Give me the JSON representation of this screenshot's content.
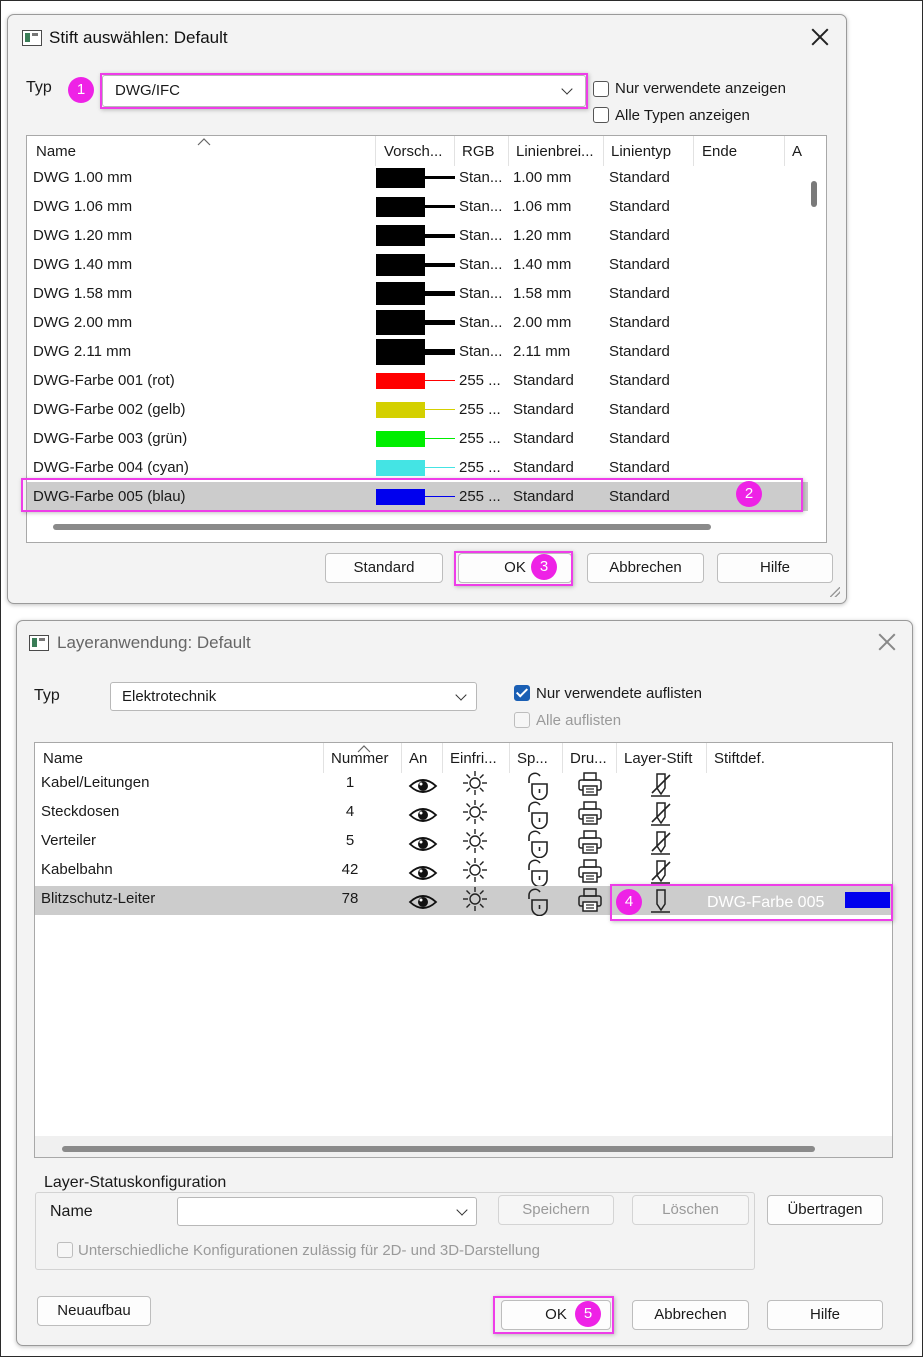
{
  "dialog1": {
    "title": "Stift auswählen: Default",
    "type_label": "Typ",
    "type_value": "DWG/IFC",
    "only_used_label": "Nur verwendete anzeigen",
    "all_types_label": "Alle Typen anzeigen",
    "columns": [
      "Name",
      "Vorsch...",
      "RGB",
      "Linienbrei...",
      "Linientyp",
      "Ende",
      "A"
    ],
    "rows": [
      {
        "name": "DWG 1.00 mm",
        "rgb": "Stan...",
        "width": "1.00 mm",
        "linetype": "Standard",
        "color": "#000000"
      },
      {
        "name": "DWG 1.06 mm",
        "rgb": "Stan...",
        "width": "1.06 mm",
        "linetype": "Standard",
        "color": "#000000"
      },
      {
        "name": "DWG 1.20 mm",
        "rgb": "Stan...",
        "width": "1.20 mm",
        "linetype": "Standard",
        "color": "#000000"
      },
      {
        "name": "DWG 1.40 mm",
        "rgb": "Stan...",
        "width": "1.40 mm",
        "linetype": "Standard",
        "color": "#000000"
      },
      {
        "name": "DWG 1.58 mm",
        "rgb": "Stan...",
        "width": "1.58 mm",
        "linetype": "Standard",
        "color": "#000000"
      },
      {
        "name": "DWG 2.00 mm",
        "rgb": "Stan...",
        "width": "2.00 mm",
        "linetype": "Standard",
        "color": "#000000"
      },
      {
        "name": "DWG 2.11 mm",
        "rgb": "Stan...",
        "width": "2.11 mm",
        "linetype": "Standard",
        "color": "#000000"
      },
      {
        "name": "DWG-Farbe 001 (rot)",
        "rgb": "255 ...",
        "width": "Standard",
        "linetype": "Standard",
        "color": "#ff0000"
      },
      {
        "name": "DWG-Farbe 002 (gelb)",
        "rgb": "255 ...",
        "width": "Standard",
        "linetype": "Standard",
        "color": "#d4d000"
      },
      {
        "name": "DWG-Farbe 003 (grün)",
        "rgb": "255 ...",
        "width": "Standard",
        "linetype": "Standard",
        "color": "#00ee00"
      },
      {
        "name": "DWG-Farbe 004 (cyan)",
        "rgb": "255 ...",
        "width": "Standard",
        "linetype": "Standard",
        "color": "#44e4e4"
      },
      {
        "name": "DWG-Farbe 005 (blau)",
        "rgb": "255 ...",
        "width": "Standard",
        "linetype": "Standard",
        "color": "#0000ee",
        "selected": true
      }
    ],
    "buttons": {
      "standard": "Standard",
      "ok": "OK",
      "cancel": "Abbrechen",
      "help": "Hilfe"
    }
  },
  "dialog2": {
    "title": "Layeranwendung: Default",
    "type_label": "Typ",
    "type_value": "Elektrotechnik",
    "only_used_label": "Nur verwendete auflisten",
    "all_label": "Alle auflisten",
    "columns": [
      "Name",
      "Nummer",
      "An",
      "Einfri...",
      "Sp...",
      "Dru...",
      "Layer-Stift",
      "Stiftdef."
    ],
    "rows": [
      {
        "name": "Kabel/Leitungen",
        "number": "1"
      },
      {
        "name": "Steckdosen",
        "number": "4"
      },
      {
        "name": "Verteiler",
        "number": "5"
      },
      {
        "name": "Kabelbahn",
        "number": "42"
      },
      {
        "name": "Blitzschutz-Leiter",
        "number": "78",
        "selected": true,
        "pen": "DWG-Farbe 005",
        "pen_color": "#0000ee"
      }
    ],
    "icons": [
      "eye-icon",
      "sun-icon",
      "lock-icon",
      "printer-icon",
      "pen-icon"
    ],
    "config_group_label": "Layer-Statuskonfiguration",
    "config_name_label": "Name",
    "config_name_value": "",
    "save_label": "Speichern",
    "delete_label": "Löschen",
    "transfer_label": "Übertragen",
    "config_checkbox_label": "Unterschiedliche Konfigurationen zulässig für 2D- und 3D-Darstellung",
    "buttons": {
      "rebuild": "Neuaufbau",
      "ok": "OK",
      "cancel": "Abbrechen",
      "help": "Hilfe"
    }
  },
  "markers": [
    "1",
    "2",
    "3",
    "4",
    "5"
  ],
  "accent_color": "#ee22e6"
}
